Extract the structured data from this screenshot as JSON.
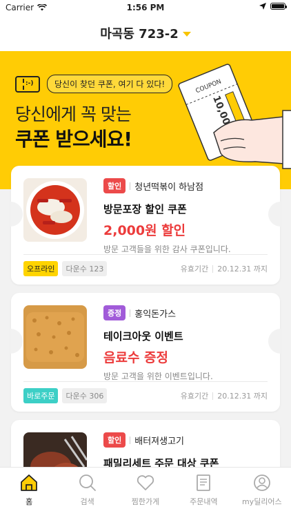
{
  "status_bar": {
    "carrier": "Carrier",
    "time": "1:56 PM"
  },
  "location": {
    "address": "마곡동 723-2"
  },
  "banner": {
    "tag_text": "당신이 찾던 쿠폰, 여기 다 있다!",
    "headline_line1": "당신에게 꼭 맞는",
    "headline_line2": "쿠폰 받으세요!",
    "illustration_text": "COUPON",
    "illustration_amount": "10,000원"
  },
  "coupons": [
    {
      "badge": "할인",
      "badge_color": "#ec4a4a",
      "store": "청년떡볶이 하남점",
      "title": "방문포장 할인 쿠폰",
      "benefit": "2,000원 할인",
      "description": "방문 고객들을 위한 감사 쿠폰입니다.",
      "type_label": "오프라인",
      "type_color": "#ffd400",
      "downloads": "다운수 123",
      "valid_label": "유효기간",
      "valid_until": "20.12.31 까지"
    },
    {
      "badge": "증정",
      "badge_color": "#a15bd9",
      "store": "홍익돈가스",
      "title": "테이크아웃 이벤트",
      "benefit": "음료수 증정",
      "description": "방문 고객을 위한 이벤트입니다.",
      "type_label": "바로주문",
      "type_color": "#3ccfc6",
      "downloads": "다운수 306",
      "valid_label": "유효기간",
      "valid_until": "20.12.31 까지"
    },
    {
      "badge": "할인",
      "badge_color": "#ec4a4a",
      "store": "배터져생고기",
      "title": "패밀리세트 주문 대상 쿠폰"
    }
  ],
  "tabbar": {
    "items": [
      {
        "label": "홈",
        "icon": "home-icon",
        "active": true
      },
      {
        "label": "검색",
        "icon": "search-icon"
      },
      {
        "label": "찜한가게",
        "icon": "heart-icon"
      },
      {
        "label": "주문내역",
        "icon": "receipt-icon"
      },
      {
        "label": "my딜리어스",
        "icon": "user-icon"
      }
    ]
  },
  "colors": {
    "accent": "#ffcc05",
    "price": "#ec3b3b"
  }
}
